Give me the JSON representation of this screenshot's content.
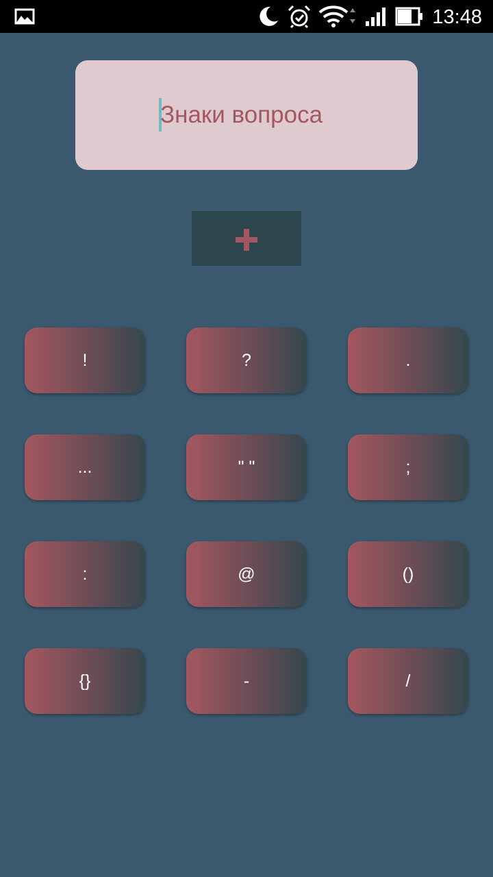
{
  "status_bar": {
    "time": "13:48",
    "icons": [
      "gallery-icon",
      "moon-icon",
      "alarm-icon",
      "wifi-icon",
      "signal-icon",
      "battery-icon"
    ]
  },
  "input": {
    "text": "Знаки вопроса"
  },
  "add_button": {
    "icon": "plus-icon"
  },
  "keys": [
    "!",
    "?",
    ".",
    "...",
    "\" \"",
    ";",
    ":",
    "@",
    "()",
    "{}",
    "-",
    "/"
  ],
  "colors": {
    "background": "#3b596e",
    "status_bar": "#000000",
    "input_bg": "#dfcad0",
    "input_text": "#a4575f",
    "cursor": "#6fbcc0",
    "add_button_bg": "#2e464d",
    "plus": "#a4575f",
    "key_gradient_start": "#a4575f",
    "key_gradient_end": "#34474e",
    "key_text": "#ffffff"
  }
}
